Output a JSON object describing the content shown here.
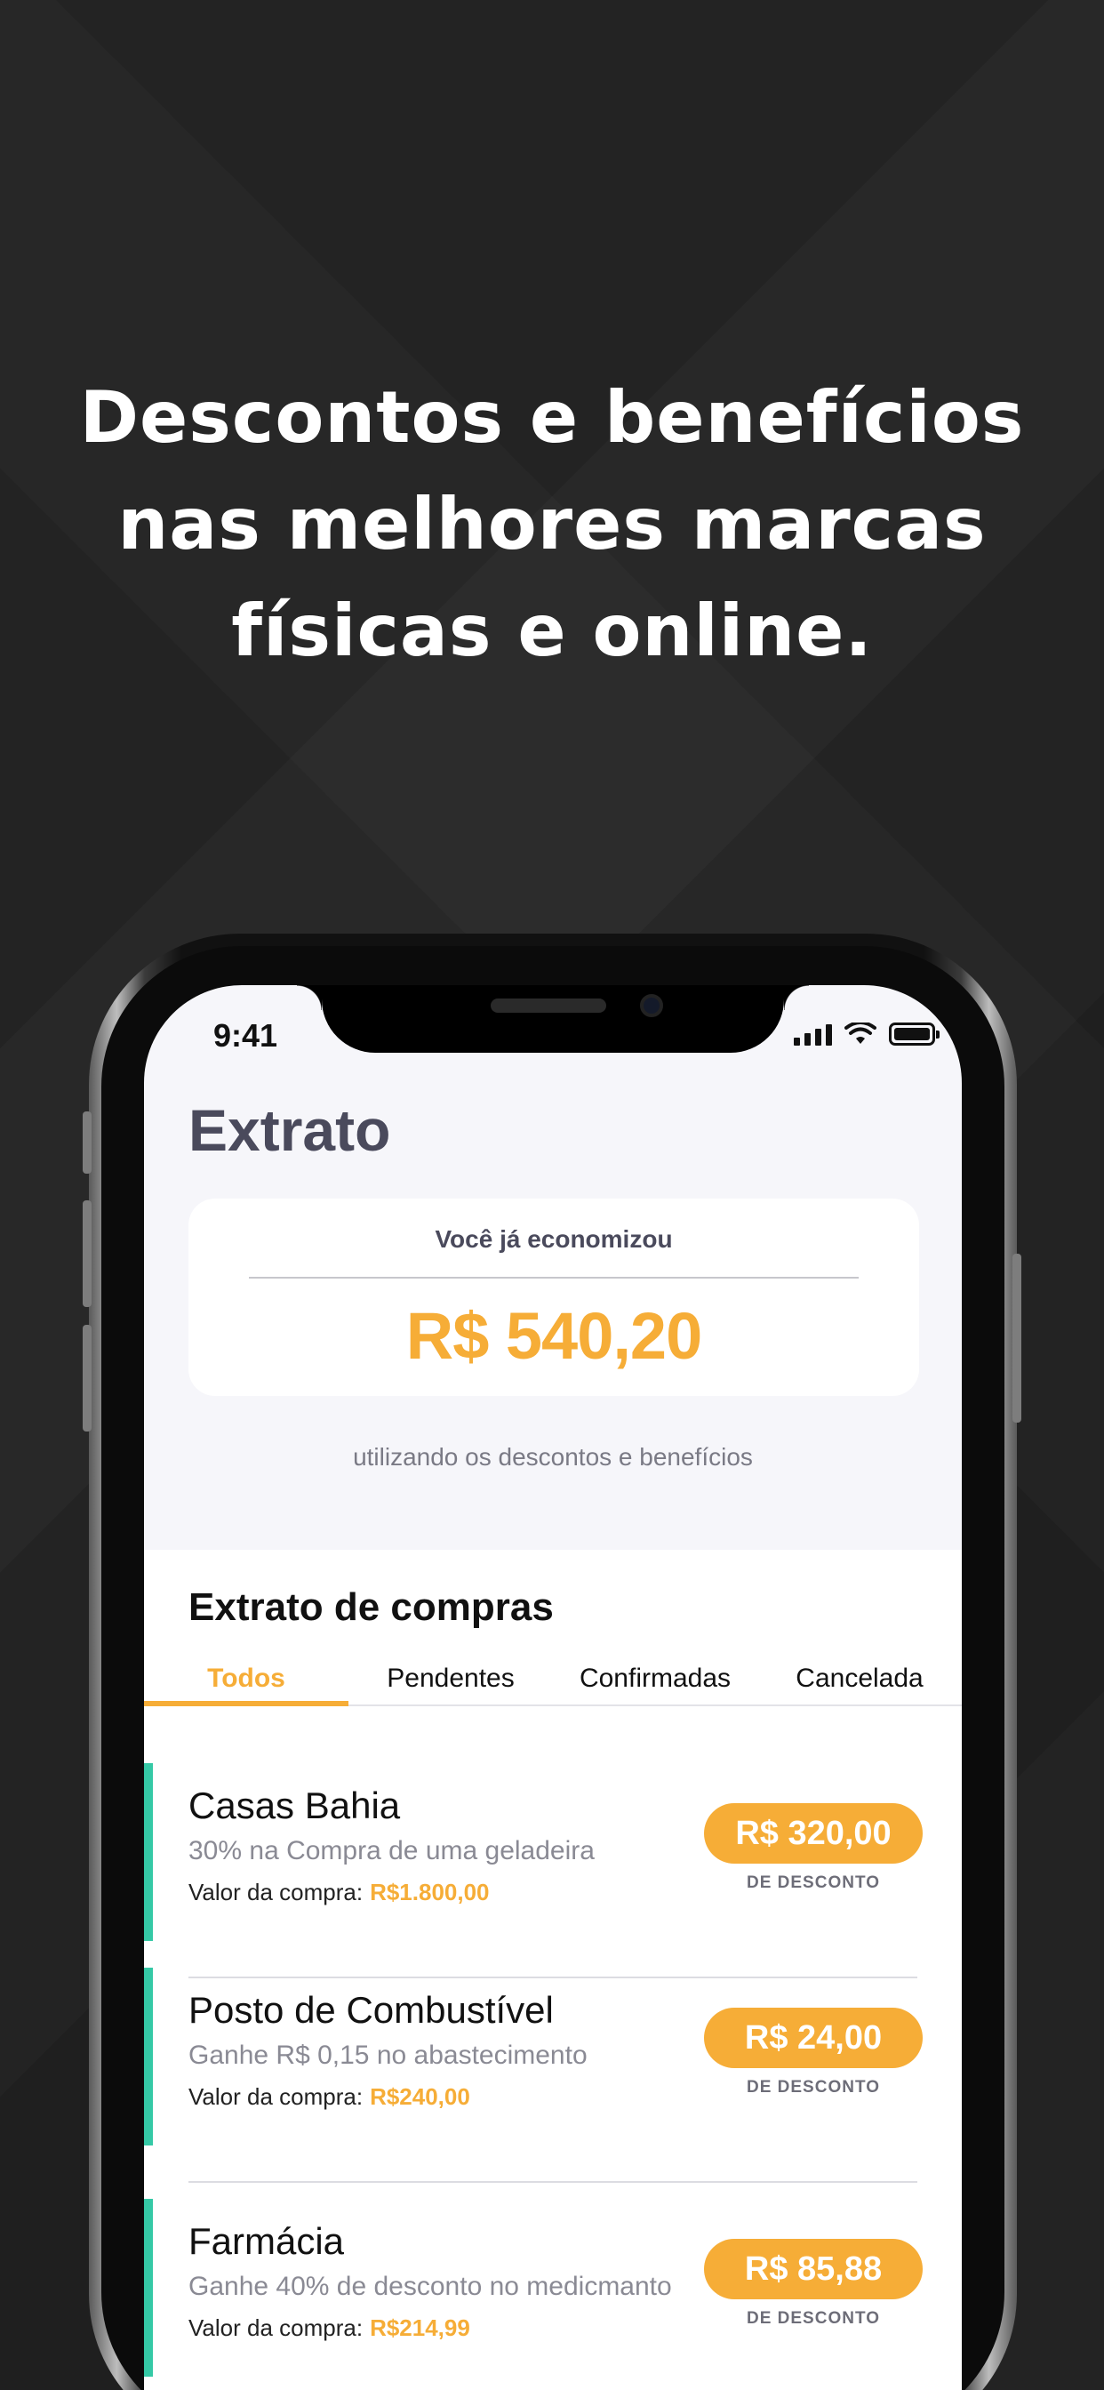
{
  "headline": {
    "line1": "Descontos e benefícios",
    "line2": "nas melhores marcas",
    "line3": "físicas e online."
  },
  "status_bar": {
    "time": "9:41",
    "icons": [
      "signal-icon",
      "wifi-icon",
      "battery-icon"
    ]
  },
  "screen": {
    "title": "Extrato",
    "savings": {
      "label": "Você já economizou",
      "amount": "R$ 540,20",
      "subtitle": "utilizando os descontos e benefícios"
    },
    "purchases": {
      "title": "Extrato de compras",
      "tabs": [
        {
          "label": "Todos",
          "active": true
        },
        {
          "label": "Pendentes",
          "active": false
        },
        {
          "label": "Confirmadas",
          "active": false
        },
        {
          "label": "Cancelada",
          "active": false
        }
      ],
      "items": [
        {
          "name": "Casas Bahia",
          "description": "30% na Compra de uma geladeira",
          "value_label": "Valor da compra:",
          "value": "R$1.800,00",
          "discount": "R$ 320,00",
          "discount_caption": "DE DESCONTO"
        },
        {
          "name": "Posto de Combustível",
          "description": "Ganhe R$ 0,15 no abastecimento",
          "value_label": "Valor da compra:",
          "value": "R$240,00",
          "discount": "R$ 24,00",
          "discount_caption": "DE DESCONTO"
        },
        {
          "name": "Farmácia",
          "description": "Ganhe 40% de desconto no medicmanto",
          "value_label": "Valor da compra:",
          "value": "R$214,99",
          "discount": "R$ 85,88",
          "discount_caption": "DE DESCONTO"
        }
      ]
    }
  },
  "colors": {
    "accent": "#f6ad37",
    "status_bar_green": "#35c9a6",
    "background": "#232323"
  }
}
